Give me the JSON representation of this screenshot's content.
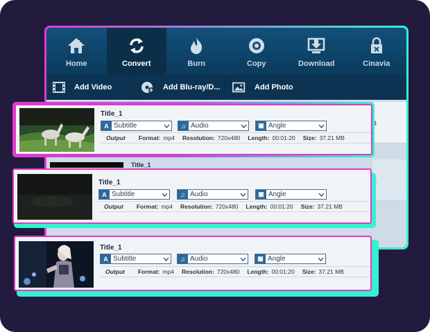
{
  "toolbar": {
    "items": [
      {
        "label": "Home",
        "icon": "home-icon"
      },
      {
        "label": "Convert",
        "icon": "convert-icon",
        "active": true
      },
      {
        "label": "Burn",
        "icon": "burn-icon"
      },
      {
        "label": "Copy",
        "icon": "copy-icon"
      },
      {
        "label": "Download",
        "icon": "download-icon"
      },
      {
        "label": "Cinavia",
        "icon": "cinavia-icon"
      }
    ]
  },
  "addbar": {
    "add_video": "Add Video",
    "add_bluray": "Add Blu-ray/D...",
    "add_photo": "Add Photo"
  },
  "background_rows": [
    {
      "size_suffix": "B",
      "title": "Title_1"
    },
    {
      "size_suffix": "B"
    }
  ],
  "cards": [
    {
      "title": "Title_1",
      "subtitle": "Subtitle",
      "audio": "Audio",
      "angle": "Angle",
      "output_label": "Output",
      "format_label": "Format:",
      "format": "mp4",
      "resolution_label": "Resolution:",
      "resolution": "720x480",
      "length_label": "Length:",
      "length": "00:01:20",
      "size_label": "Size:",
      "size": "37.21 MB"
    },
    {
      "title": "Title_1",
      "subtitle": "Subtitle",
      "audio": "Audio",
      "angle": "Angle",
      "output_label": "Output",
      "format_label": "Format:",
      "format": "mp4",
      "resolution_label": "Resolution:",
      "resolution": "720x480",
      "length_label": "Length:",
      "length": "00:01:20",
      "size_label": "Size:",
      "size": "37.21 MB"
    },
    {
      "title": "Title_1",
      "subtitle": "Subtitle",
      "audio": "Audio",
      "angle": "Angle",
      "output_label": "Output",
      "format_label": "Format:",
      "format": "mp4",
      "resolution_label": "Resolution:",
      "resolution": "720x480",
      "length_label": "Length:",
      "length": "00:01:20",
      "size_label": "Size:",
      "size": "37.21 MB"
    }
  ],
  "colors": {
    "background": "#221b3e",
    "toolbar": "#12507a",
    "card_border": "#e237c8",
    "glow": "#36f0d2"
  }
}
